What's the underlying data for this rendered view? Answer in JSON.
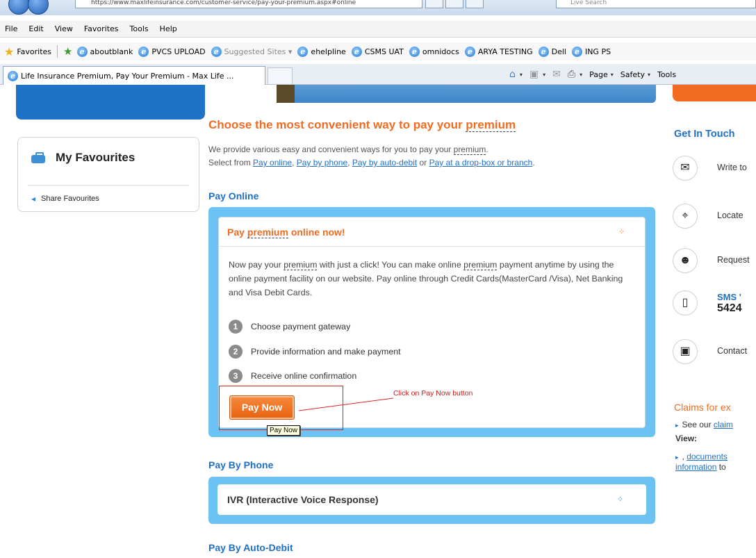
{
  "browser": {
    "address_url": "https://www.maxlifeinsurance.com/customer-service/pay-your-premium.aspx#online",
    "live_search_placeholder": "Live Search",
    "menu": [
      "File",
      "Edit",
      "View",
      "Favorites",
      "Tools",
      "Help"
    ],
    "favorites_label": "Favorites",
    "favorites_bar": [
      {
        "label": "aboutblank",
        "dim": false
      },
      {
        "label": "PVCS UPLOAD",
        "dim": false
      },
      {
        "label": "Suggested Sites ▾",
        "dim": true
      },
      {
        "label": "ehelpline",
        "dim": false
      },
      {
        "label": "CSMS UAT",
        "dim": false
      },
      {
        "label": "omnidocs",
        "dim": false
      },
      {
        "label": "ARYA TESTING",
        "dim": false
      },
      {
        "label": "Dell",
        "dim": false
      },
      {
        "label": "ING PS",
        "dim": false
      }
    ],
    "tab_title": "Life Insurance Premium, Pay Your Premium - Max Life ...",
    "cmd": {
      "page": "Page",
      "safety": "Safety",
      "tools": "Tools"
    }
  },
  "left": {
    "favourites_title": "My Favourites",
    "share_label": "Share Favourites"
  },
  "main": {
    "heading_prefix": "Choose the most convenient way to pay your ",
    "heading_term": "premium",
    "intro_line1_prefix": "We provide various easy and convenient ways for you to pay your ",
    "intro_line1_term": "premium",
    "intro_line1_suffix": ".",
    "intro_line2_prefix": "Select from ",
    "links": [
      "Pay online",
      "Pay by phone",
      "Pay by auto-debit",
      "Pay at a drop-box or branch"
    ],
    "sep_comma": ", ",
    "sep_or": " or ",
    "intro_line2_suffix": ".",
    "pay_online_heading": "Pay Online",
    "panel_title_prefix": "Pay ",
    "panel_title_term": "premium",
    "panel_title_suffix": " online now!",
    "desc": {
      "p1": "Now pay your ",
      "t1": "premium",
      "p2": " with just a click! You can make online ",
      "t2": "premium",
      "p3": " payment anytime by using the online payment facility on our website. Pay online through Credit Cards(MasterCard /Visa), Net Banking and Visa Debit Cards."
    },
    "steps": [
      {
        "num": "1",
        "text": "Choose payment gateway"
      },
      {
        "num": "2",
        "text": "Provide information and make payment"
      },
      {
        "num": "3",
        "text": "Receive online confirmation"
      }
    ],
    "pay_now_label": "Pay Now",
    "tooltip": "Pay Now",
    "annotation": "Click on Pay Now button",
    "pay_by_phone_heading": "Pay By Phone",
    "ivr_label": "IVR (Interactive Voice Response)",
    "pay_by_auto_debit_heading": "Pay By Auto-Debit"
  },
  "right": {
    "get_in_touch": "Get In Touch",
    "contacts": [
      {
        "icon": "envelope-icon",
        "glyph": "✉",
        "label": "Write to"
      },
      {
        "icon": "locate-icon",
        "glyph": "⌖",
        "label": "Locate"
      },
      {
        "icon": "person-icon",
        "glyph": "☻",
        "label": "Request"
      },
      {
        "icon": "mobile-icon",
        "glyph": "▯",
        "label": "SMS '"
      },
      {
        "icon": "camera-icon",
        "glyph": "▣",
        "label": "Contact"
      }
    ],
    "sms_number": "5424",
    "claims_heading": "Claims for ex",
    "claims_line1_prefix": "See our ",
    "claims_line1_link": "claim",
    "view_label": "View:",
    "claims_line3_prefix": ", ",
    "claims_line3_link": "documents",
    "claims_line4_link": "information",
    "claims_line4_suffix": " to"
  },
  "colors": {
    "accent_orange": "#f26b21",
    "link_blue": "#1f6fc4",
    "panel_blue": "#6cc3f3",
    "annotation_red": "#e02020"
  }
}
